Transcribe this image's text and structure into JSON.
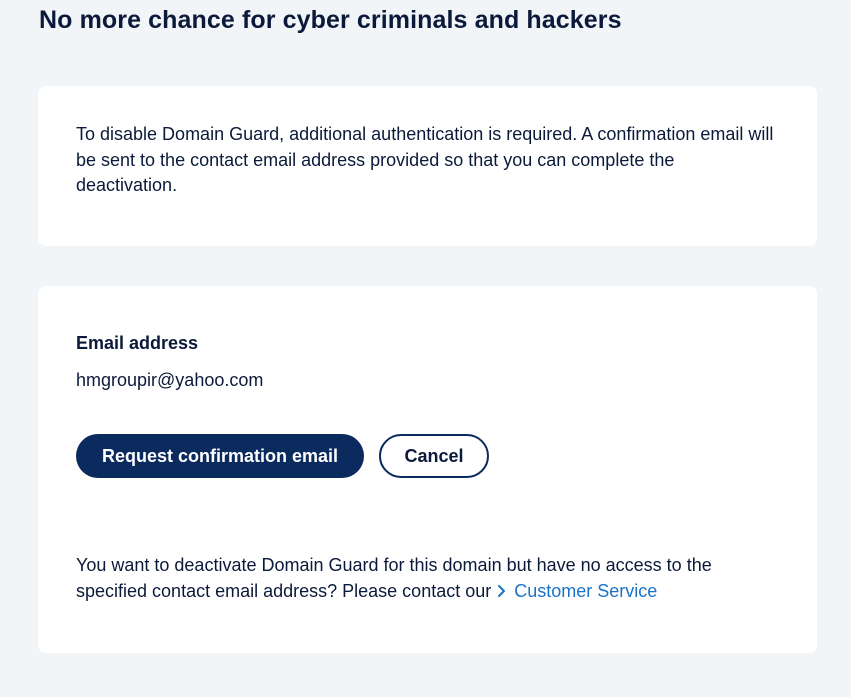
{
  "page": {
    "title": "No more chance for cyber criminals and hackers"
  },
  "info_card": {
    "text": "To disable Domain Guard, additional authentication is required. A confirmation email will be sent to the contact email address provided so that you can complete the deactivation."
  },
  "form_card": {
    "email_label": "Email address",
    "email_value": "hmgroupir@yahoo.com",
    "request_button_label": "Request confirmation email",
    "cancel_button_label": "Cancel",
    "help_text": "You want to deactivate Domain Guard for this domain but have no access to the specified contact email address? Please contact our",
    "help_link_label": "Customer Service",
    "help_link_icon": "chevron-right-icon"
  },
  "colors": {
    "background": "#f2f5f8",
    "card": "#ffffff",
    "primary": "#0b2a5e",
    "text": "#0b1a3a",
    "link": "#1a73c8"
  }
}
